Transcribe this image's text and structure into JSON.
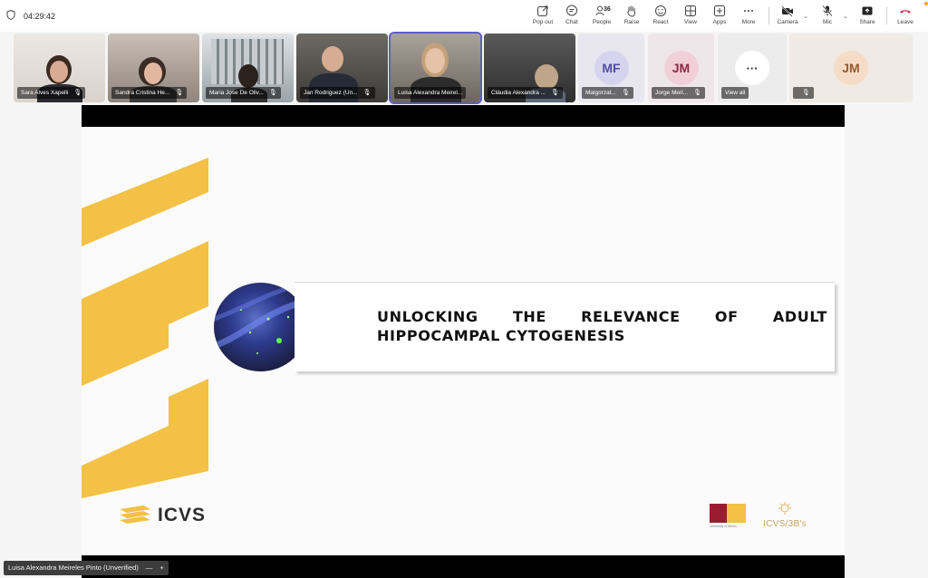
{
  "toolbar": {
    "timer": "04:29:42",
    "popout_label": "Pop out",
    "chat_label": "Chat",
    "people_label": "People",
    "people_count": "36",
    "raise_label": "Raise",
    "react_label": "React",
    "view_label": "View",
    "apps_label": "Apps",
    "more_label": "More",
    "camera_label": "Camera",
    "mic_label": "Mic",
    "share_label": "Share",
    "leave_label": "Leave"
  },
  "participants": [
    {
      "name": "Sara Alves Xapelli"
    },
    {
      "name": "Sandra Cristina He..."
    },
    {
      "name": "Maria Jose De Oliv..."
    },
    {
      "name": "Jan Rodriguez (Un..."
    },
    {
      "name": "Luisa Alexandra Meirel..."
    },
    {
      "name": "Cláudia Alexandra ..."
    },
    {
      "name": "Malgorzat...",
      "initials": "MF"
    },
    {
      "name": "Jorge Meri...",
      "initials": "JM"
    },
    {
      "name": "View all",
      "glyph": "···"
    },
    {
      "name": "",
      "initials": "JM"
    }
  ],
  "slide": {
    "title": "UNLOCKING THE RELEVANCE OF ADULT HIPPOCAMPAL CYTOGENESIS",
    "logo_text": "ICVS",
    "partner_logo_text": "ICVS/3B's",
    "uminho_caption": "University of Minho"
  },
  "presenter_label": "Luisa Alexandra Meireles Pinto (Unverified)",
  "presenter_controls": {
    "minus": "—",
    "plus": "+"
  },
  "colors": {
    "accent": "#5b5fc7",
    "leave_red": "#c4314b",
    "slide_yellow": "#f2c145",
    "uminho_red": "#9b1c2e"
  }
}
